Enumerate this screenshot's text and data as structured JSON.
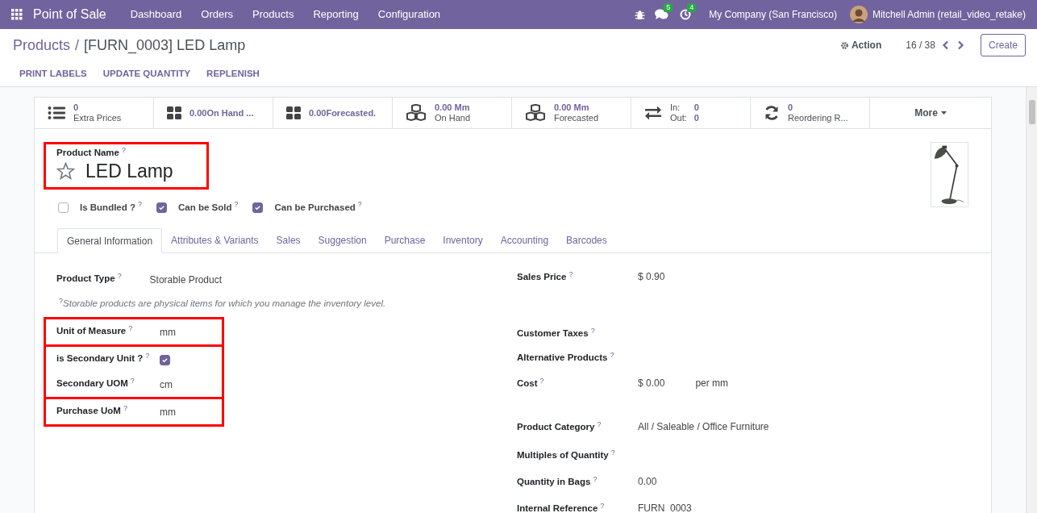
{
  "navbar": {
    "app": "Point of Sale",
    "menus": [
      "Dashboard",
      "Orders",
      "Products",
      "Reporting",
      "Configuration"
    ],
    "messages_badge": "5",
    "activities_badge": "4",
    "company": "My Company (San Francisco)",
    "user": "Mitchell Admin (retail_video_retake)"
  },
  "breadcrumb": {
    "parent": "Products",
    "separator": "/",
    "current": "[FURN_0003] LED Lamp"
  },
  "controls": {
    "action": "Action",
    "pager": "16 / 38",
    "create": "Create"
  },
  "header_buttons": [
    "PRINT LABELS",
    "UPDATE QUANTITY",
    "REPLENISH"
  ],
  "stat_buttons": [
    {
      "value": "0",
      "label": "Extra Prices"
    },
    {
      "value": "0.00On Hand ..."
    },
    {
      "value": "0.00Forecasted."
    },
    {
      "value": "0.00 Mm",
      "label": "On Hand"
    },
    {
      "value": "0.00 Mm",
      "label": "Forecasted"
    },
    {
      "lines": [
        {
          "label": "In:",
          "value": "0"
        },
        {
          "label": "Out:",
          "value": "0"
        }
      ]
    },
    {
      "value": "0",
      "label": "Reordering R..."
    }
  ],
  "more": {
    "label": "More"
  },
  "product": {
    "name_label": "Product Name",
    "help": "?",
    "name": "LED Lamp",
    "favorite": false,
    "highlighted": true
  },
  "options": [
    {
      "label": "Is Bundled ?",
      "help": "?",
      "checked": false
    },
    {
      "label": "Can be Sold",
      "help": "?",
      "checked": true
    },
    {
      "label": "Can be Purchased",
      "help": "?",
      "checked": true
    }
  ],
  "tabs": [
    {
      "label": "General Information",
      "selected": true
    },
    {
      "label": "Attributes & Variants",
      "selected": false
    },
    {
      "label": "Sales",
      "selected": false
    },
    {
      "label": "Suggestion",
      "selected": false
    },
    {
      "label": "Purchase",
      "selected": false
    },
    {
      "label": "Inventory",
      "selected": false
    },
    {
      "label": "Accounting",
      "selected": false
    },
    {
      "label": "Barcodes",
      "selected": false
    }
  ],
  "left_groups": [
    {
      "highlighted": false,
      "fields": [
        {
          "kind": "text",
          "label": "Product Type",
          "help": "?",
          "value": "Storable Product"
        },
        {
          "kind": "note",
          "help": "?",
          "value": "Storable products are physical items for which you manage the inventory level."
        }
      ]
    },
    {
      "highlighted": true,
      "fields": [
        {
          "kind": "text",
          "label": "Unit of Measure",
          "help": "?",
          "value": "mm"
        }
      ]
    },
    {
      "highlighted": true,
      "fields": [
        {
          "kind": "checkbox",
          "label": "is Secondary Unit ?",
          "help": "?",
          "checked": true
        },
        {
          "kind": "text",
          "label": "Secondary UOM",
          "help": "?",
          "value": "cm"
        }
      ]
    },
    {
      "highlighted": true,
      "fields": [
        {
          "kind": "text",
          "label": "Purchase UoM",
          "help": "?",
          "value": "mm"
        }
      ]
    }
  ],
  "right_fields": [
    {
      "label": "Sales Price",
      "help": "?",
      "value": "$ 0.90"
    },
    {
      "label": "Customer Taxes",
      "help": "?"
    },
    {
      "label": "Alternative Products",
      "help": "?"
    },
    {
      "label": "Cost",
      "help": "?",
      "value": "$ 0.00",
      "suffix": "per mm"
    },
    {
      "label": "Product Category",
      "help": "?",
      "value": "All / Saleable / Office Furniture"
    },
    {
      "label": "Multiples of Quantity",
      "help": "?"
    },
    {
      "label": "Quantity in Bags",
      "help": "?",
      "value": "0.00"
    },
    {
      "label": "Internal Reference",
      "help": "?",
      "value": "FURN_0003"
    }
  ]
}
